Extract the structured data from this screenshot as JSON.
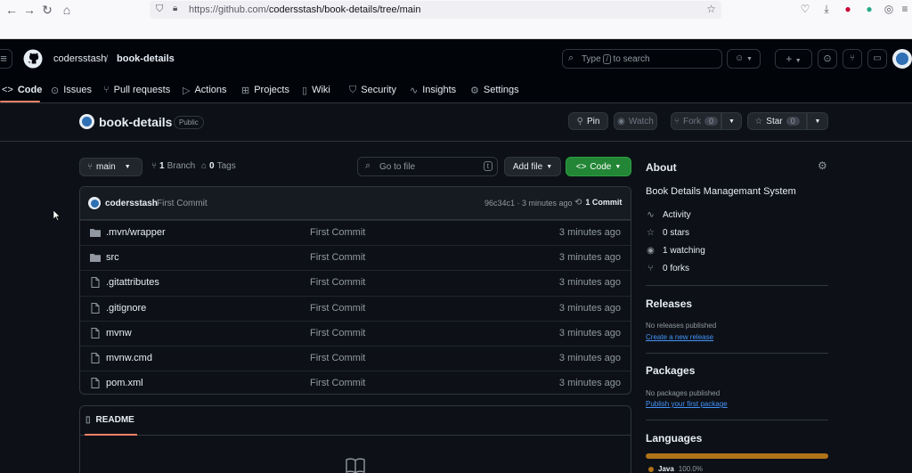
{
  "browser": {
    "url_host": "https://github.com/",
    "url_path": "codersstash/book-details/tree/main"
  },
  "header": {
    "owner": "codersstash",
    "slash": "/",
    "repo": "book-details",
    "search_prefix": "Type",
    "search_key": "/",
    "search_suffix": "to search"
  },
  "tabs": [
    {
      "label": "Code",
      "icon": "code-icon"
    },
    {
      "label": "Issues",
      "icon": "issue-icon"
    },
    {
      "label": "Pull requests",
      "icon": "pull-request-icon"
    },
    {
      "label": "Actions",
      "icon": "play-icon"
    },
    {
      "label": "Projects",
      "icon": "table-icon"
    },
    {
      "label": "Wiki",
      "icon": "book-icon"
    },
    {
      "label": "Security",
      "icon": "shield-icon"
    },
    {
      "label": "Insights",
      "icon": "graph-icon"
    },
    {
      "label": "Settings",
      "icon": "gear-icon"
    }
  ],
  "repo": {
    "name": "book-details",
    "visibility": "Public",
    "pin_label": "Pin",
    "watch_label": "Watch",
    "fork_label": "Fork",
    "fork_count": "0",
    "star_label": "Star",
    "star_count": "0"
  },
  "toolbar": {
    "branch": "main",
    "branch_count": "1",
    "branch_label": "Branch",
    "tag_count": "0",
    "tag_label": "Tags",
    "goto_placeholder": "Go to file",
    "goto_key": "t",
    "add_file": "Add file",
    "code": "Code"
  },
  "commit": {
    "author": "codersstash",
    "message": "First Commit",
    "hash_time": "96c34c1 · 3 minutes ago",
    "count_label": "1 Commit"
  },
  "files": [
    {
      "name": ".mvn/wrapper",
      "type": "folder",
      "commit": "First Commit",
      "time": "3 minutes ago"
    },
    {
      "name": "src",
      "type": "folder",
      "commit": "First Commit",
      "time": "3 minutes ago"
    },
    {
      "name": ".gitattributes",
      "type": "file",
      "commit": "First Commit",
      "time": "3 minutes ago"
    },
    {
      "name": ".gitignore",
      "type": "file",
      "commit": "First Commit",
      "time": "3 minutes ago"
    },
    {
      "name": "mvnw",
      "type": "file",
      "commit": "First Commit",
      "time": "3 minutes ago"
    },
    {
      "name": "mvnw.cmd",
      "type": "file",
      "commit": "First Commit",
      "time": "3 minutes ago"
    },
    {
      "name": "pom.xml",
      "type": "file",
      "commit": "First Commit",
      "time": "3 minutes ago"
    }
  ],
  "readme": {
    "label": "README"
  },
  "about": {
    "title": "About",
    "description": "Book Details Managemant System",
    "activity": "Activity",
    "stars": "0 stars",
    "watching": "1 watching",
    "forks": "0 forks"
  },
  "releases": {
    "title": "Releases",
    "none": "No releases published",
    "link": "Create a new release"
  },
  "packages": {
    "title": "Packages",
    "none": "No packages published",
    "link": "Publish your first package"
  },
  "languages": {
    "title": "Languages",
    "items": [
      {
        "name": "Java",
        "percent": "100.0%",
        "color": "#b07219"
      }
    ]
  },
  "colors": {
    "bg": "#0d1117",
    "header_bg": "#010409",
    "border": "#30363d",
    "accent_tab": "#f78166",
    "green": "#238636",
    "link": "#4493f8",
    "java": "#b07219"
  }
}
